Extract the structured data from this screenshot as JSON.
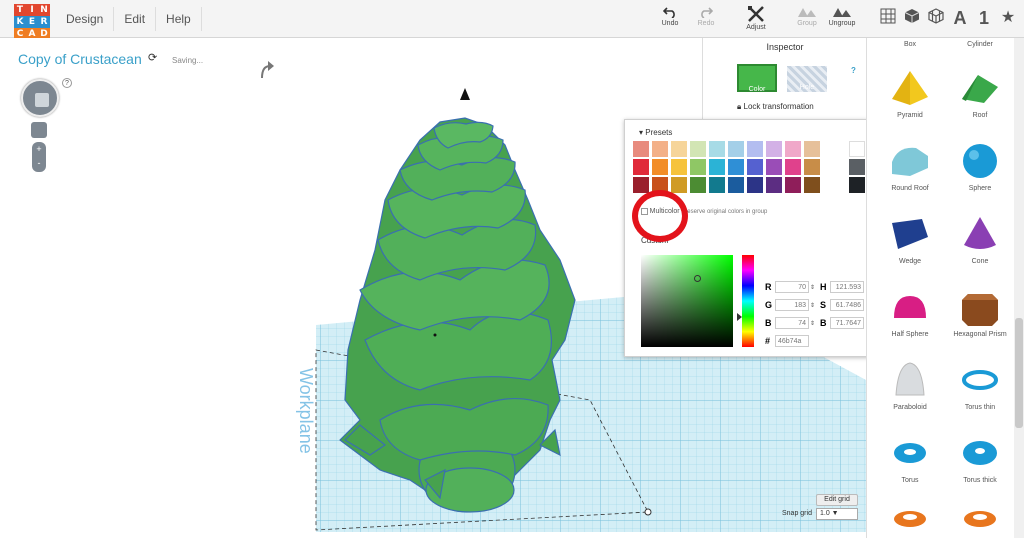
{
  "app": {
    "logo_letters": [
      "T",
      "I",
      "N",
      "K",
      "E",
      "R",
      "C",
      "A",
      "D"
    ],
    "logo_colors": [
      "#e2472f",
      "#e2472f",
      "#e2472f",
      "#2b8fcf",
      "#2b8fcf",
      "#2b8fcf",
      "#ef7d22",
      "#ef7d22",
      "#ef7d22"
    ]
  },
  "menu": {
    "items": [
      "Design",
      "Edit",
      "Help"
    ]
  },
  "toolbar": {
    "undo": "Undo",
    "redo": "Redo",
    "adjust": "Adjust",
    "group": "Group",
    "ungroup": "Ungroup",
    "letter_icon": "A",
    "number_icon": "1",
    "star_icon": "★"
  },
  "document": {
    "title": "Copy of Crustacean",
    "status": "Saving...",
    "help": "?"
  },
  "inspector": {
    "title": "Inspector",
    "color_label": "Color",
    "hole_label": "Hole",
    "help": "?",
    "lock_label": "Lock transformation"
  },
  "color_panel": {
    "presets_title": "Presets",
    "preset_colors": [
      "#e88b7e",
      "#f3b088",
      "#f6d59a",
      "#d2e5b4",
      "#a7dbe6",
      "#a4cfe8",
      "#b3bdf0",
      "#d3b1e6",
      "#f0a8c9",
      "#e6c09a",
      "#e02a3a",
      "#f28d28",
      "#f6c33b",
      "#8fc765",
      "#2bb3d6",
      "#2f8fd6",
      "#5561d0",
      "#9a4db7",
      "#e0418c",
      "#c88d48",
      "#9a1f2c",
      "#c8511b",
      "#d09b25",
      "#4c8c33",
      "#127a8e",
      "#1b5c9e",
      "#2c3487",
      "#5c2d82",
      "#8f1e5a",
      "#7f4f1d"
    ],
    "extra_colors": [
      "#ffffff",
      "#c8ccd0",
      "#2f3337"
    ],
    "side_colors": [
      "#b0b4b8",
      "#5a5f64",
      "#1e2226"
    ],
    "multi_label": "Multicolor",
    "multi_desc": "Preserve original colors in group",
    "custom_label": "Custom",
    "r": "70",
    "g": "183",
    "b": "74",
    "h": "121.593",
    "s": "61.7486",
    "v": "71.7647",
    "hex": "46b74a",
    "label_r": "R",
    "label_g": "G",
    "label_b": "B",
    "label_h": "H",
    "label_s": "S",
    "label_v": "B",
    "label_hex": "#"
  },
  "workplane": {
    "label": "Workplane",
    "edit_grid": "Edit grid",
    "snap_label": "Snap grid",
    "snap_value": "1.0 ▼"
  },
  "shapes": [
    {
      "name": "Box",
      "color": "#d33"
    },
    {
      "name": "Cylinder",
      "color": "#e67"
    },
    {
      "name": "Pyramid",
      "color": "#f2c81e"
    },
    {
      "name": "Roof",
      "color": "#3aa84a"
    },
    {
      "name": "Round Roof",
      "color": "#7fc8d8"
    },
    {
      "name": "Sphere",
      "color": "#1a9ad6"
    },
    {
      "name": "Wedge",
      "color": "#1f3f8f"
    },
    {
      "name": "Cone",
      "color": "#8a3fb3"
    },
    {
      "name": "Half Sphere",
      "color": "#d81e84"
    },
    {
      "name": "Hexagonal Prism",
      "color": "#8a4a1e"
    },
    {
      "name": "Paraboloid",
      "color": "#d9dcdf"
    },
    {
      "name": "Torus thin",
      "color": "#1a9ad6"
    },
    {
      "name": "Torus",
      "color": "#1a9ad6"
    },
    {
      "name": "Torus thick",
      "color": "#1a9ad6"
    },
    {
      "name": "",
      "color": "#e8761e"
    },
    {
      "name": "",
      "color": "#e8761e"
    }
  ]
}
